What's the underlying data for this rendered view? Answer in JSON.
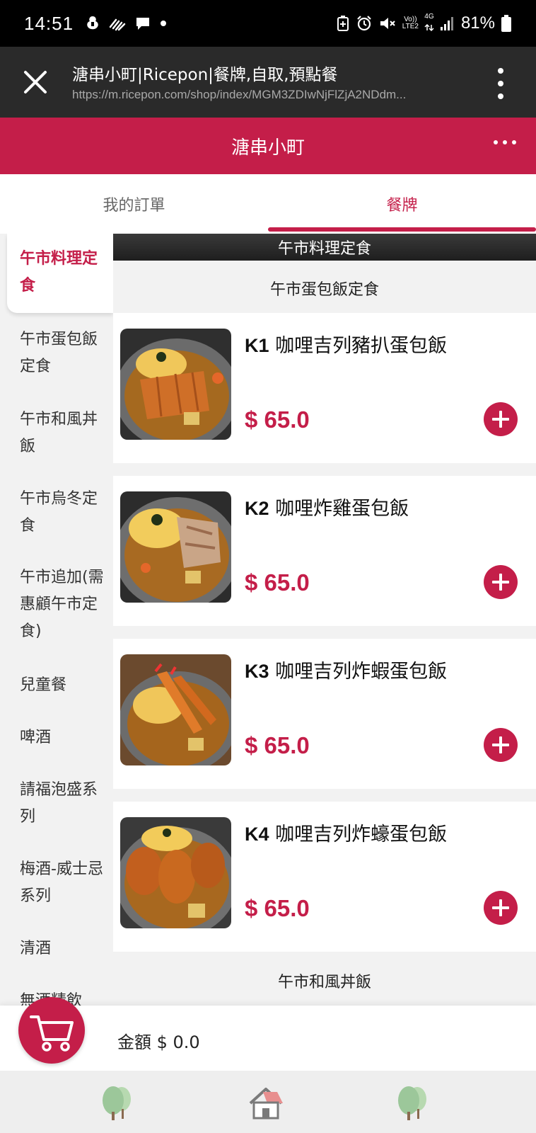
{
  "status_bar": {
    "time": "14:51",
    "network_volte": "Vo))",
    "network_lte": "LTE2",
    "network_type": "4G",
    "battery": "81%"
  },
  "browser": {
    "title": "溏串小町|Ricepon|餐牌,自取,預點餐",
    "url": "https://m.ricepon.com/shop/index/MGM3ZDIwNjFlZjA2NDdm..."
  },
  "header": {
    "shop_name": "溏串小町"
  },
  "tabs": [
    {
      "label": "我的訂單",
      "active": false
    },
    {
      "label": "餐牌",
      "active": true
    }
  ],
  "sidebar": {
    "categories": [
      {
        "label": "午市料理定食",
        "active": true
      },
      {
        "label": "午市蛋包飯定食",
        "active": false
      },
      {
        "label": "午市和風丼飯",
        "active": false
      },
      {
        "label": "午市烏冬定食",
        "active": false
      },
      {
        "label": "午市追加(需惠顧午市定食)",
        "active": false
      },
      {
        "label": "兒童餐",
        "active": false
      },
      {
        "label": "啤酒",
        "active": false
      },
      {
        "label": "請福泡盛系列",
        "active": false
      },
      {
        "label": "梅酒-威士忌系列",
        "active": false
      },
      {
        "label": "清酒",
        "active": false
      },
      {
        "label": "無酒精飲",
        "active": false
      }
    ]
  },
  "menu": {
    "section_title": "午市料理定食",
    "subsection_1": "午市蛋包飯定食",
    "items": [
      {
        "code": "K1",
        "name": "咖哩吉列豬扒蛋包飯",
        "price": "$ 65.0"
      },
      {
        "code": "K2",
        "name": "咖哩炸雞蛋包飯",
        "price": "$ 65.0"
      },
      {
        "code": "K3",
        "name": "咖哩吉列炸蝦蛋包飯",
        "price": "$ 65.0"
      },
      {
        "code": "K4",
        "name": "咖哩吉列炸蠔蛋包飯",
        "price": "$ 65.0"
      }
    ],
    "subsection_2": "午市和風丼飯"
  },
  "cart": {
    "total_label": "金額 $ 0.0"
  },
  "bottom_nav": [
    {
      "icon": "trees-icon"
    },
    {
      "icon": "house-icon"
    },
    {
      "icon": "trees-icon"
    }
  ],
  "colors": {
    "accent": "#c41e49",
    "browser_bar": "#2a2a2a",
    "background": "#f2f2f2"
  }
}
